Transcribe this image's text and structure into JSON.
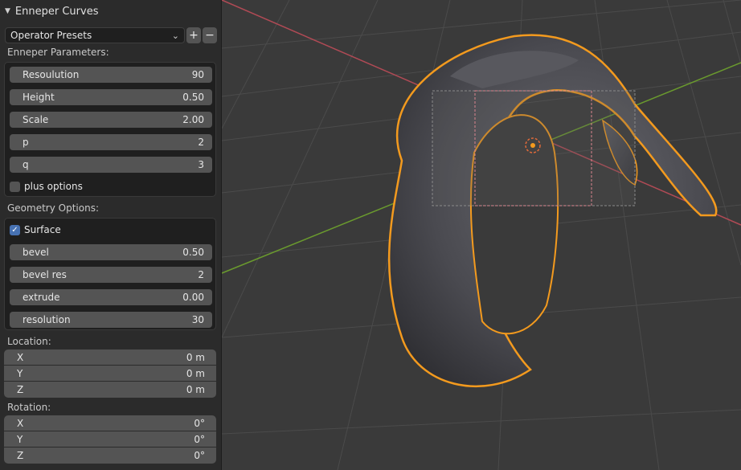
{
  "panel": {
    "title": "Enneper Curves",
    "presets": {
      "label": "Operator Presets"
    },
    "enneper_section": "Enneper Parameters:",
    "enneper_fields": [
      {
        "label": "Resoulution",
        "value": "90"
      },
      {
        "label": "Height",
        "value": "0.50"
      },
      {
        "label": "Scale",
        "value": "2.00"
      },
      {
        "label": "p",
        "value": "2"
      },
      {
        "label": "q",
        "value": "3"
      }
    ],
    "plus_options": {
      "label": "plus options",
      "checked": false
    },
    "geometry_section": "Geometry Options:",
    "surface": {
      "label": "Surface",
      "checked": true
    },
    "geometry_fields": [
      {
        "label": "bevel",
        "value": "0.50"
      },
      {
        "label": "bevel res",
        "value": "2"
      },
      {
        "label": "extrude",
        "value": "0.00"
      },
      {
        "label": "resolution",
        "value": "30"
      }
    ],
    "location_section": "Location:",
    "location": [
      {
        "axis": "X",
        "value": "0 m"
      },
      {
        "axis": "Y",
        "value": "0 m"
      },
      {
        "axis": "Z",
        "value": "0 m"
      }
    ],
    "rotation_section": "Rotation:",
    "rotation": [
      {
        "axis": "X",
        "value": "0°"
      },
      {
        "axis": "Y",
        "value": "0°"
      },
      {
        "axis": "Z",
        "value": "0°"
      }
    ]
  },
  "viewport": {
    "object": "Enneper curve mesh (selected)",
    "colors": {
      "background": "#3a3a3a",
      "grid": "#4b4b4b",
      "x_axis": "#b04a55",
      "y_axis": "#6a9a2e",
      "selection_outline": "#f39a1e",
      "mesh": "#4d4d52"
    }
  }
}
